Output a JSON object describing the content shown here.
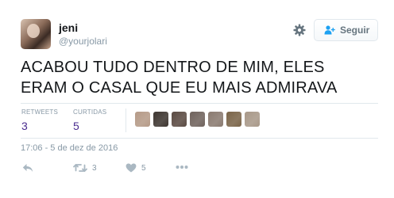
{
  "tweet": {
    "user_name": "jeni",
    "user_handle": "@yourjolari",
    "text_line1": "ACABOU TUDO DENTRO DE MIM, ELES",
    "text_line2": "ERAM O CASAL QUE EU MAIS ADMIRAVA",
    "timestamp": "17:06 - 5 de dez de 2016"
  },
  "header": {
    "follow_label": "Seguir",
    "settings_icon": "gear-icon",
    "follow_icon": "add-user-icon"
  },
  "stats": {
    "retweets_label": "RETWEETS",
    "retweets_value": "3",
    "likes_label": "CURTIDAS",
    "likes_value": "5"
  },
  "likers": [
    {
      "icon": "avatar",
      "color": "#b59a87"
    },
    {
      "icon": "avatar",
      "color": "#3d3530"
    },
    {
      "icon": "avatar",
      "color": "#5a4a42"
    },
    {
      "icon": "avatar",
      "color": "#6f625c"
    },
    {
      "icon": "avatar",
      "color": "#8a7a70"
    },
    {
      "icon": "avatar",
      "color": "#7a6448"
    },
    {
      "icon": "avatar",
      "color": "#a89888"
    }
  ],
  "actions": {
    "reply_icon": "reply-icon",
    "retweet_icon": "retweet-icon",
    "retweet_count": "3",
    "like_icon": "heart-icon",
    "like_count": "5",
    "more_icon": "more-icon"
  },
  "colors": {
    "text": "#14171a",
    "muted": "#8899a6",
    "stat_value": "#4a2c8f",
    "border": "#e1e8ed",
    "icon": "#aab8c2"
  }
}
